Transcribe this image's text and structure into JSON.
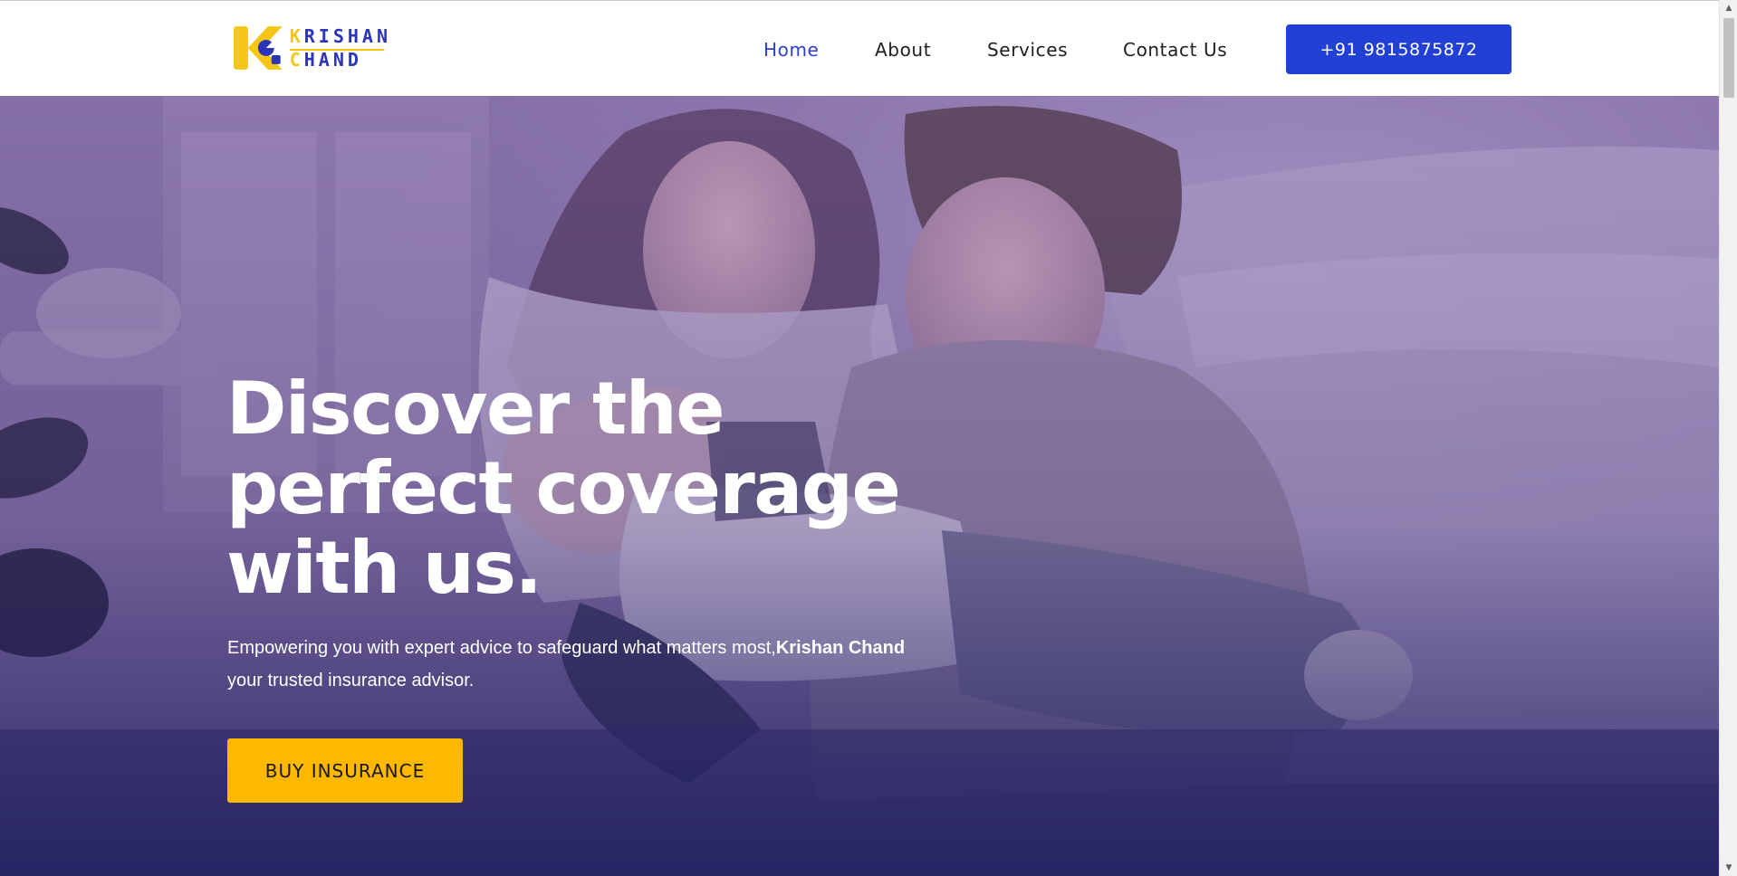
{
  "brand": {
    "line1": "KRISHAN",
    "line2": "CHAND",
    "colors": {
      "blue": "#2c35b8",
      "yellow": "#f5c518"
    }
  },
  "nav": {
    "items": [
      {
        "label": "Home",
        "active": true
      },
      {
        "label": "About",
        "active": false
      },
      {
        "label": "Services",
        "active": false
      },
      {
        "label": "Contact Us",
        "active": false
      }
    ],
    "phone_label": "+91 9815875872"
  },
  "hero": {
    "title": "Discover the perfect coverage with us.",
    "subtitle_pre": "Empowering you with expert advice to safeguard what matters most,",
    "subtitle_bold": "Krishan Chand",
    "subtitle_post": " your trusted insurance advisor.",
    "cta_label": "BUY INSURANCE"
  },
  "colors": {
    "accent_blue": "#2340d6",
    "cta_yellow": "#ffb800",
    "active_nav": "#2c3fd1"
  },
  "icons": {
    "scroll_up": "▲",
    "scroll_down": "▼"
  }
}
